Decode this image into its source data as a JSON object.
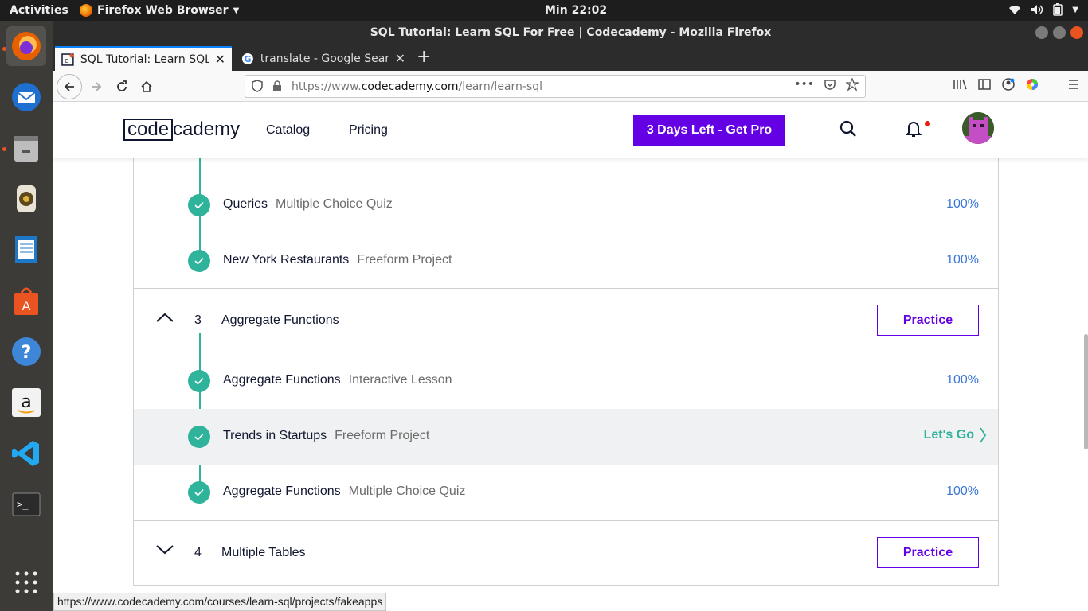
{
  "system": {
    "activities": "Activities",
    "app_menu": "Firefox Web Browser",
    "clock": "Min 22:02"
  },
  "window": {
    "title": "SQL Tutorial: Learn SQL For Free | Codecademy - Mozilla Firefox"
  },
  "tabs": [
    {
      "label": "SQL Tutorial: Learn SQL For Free",
      "active": true
    },
    {
      "label": "translate - Google Search",
      "active": false
    }
  ],
  "urlbar": {
    "prefix": "https://www.",
    "domain": "codecademy.com",
    "path": "/learn/learn-sql"
  },
  "site": {
    "logo_left": "code",
    "logo_right": "cademy",
    "nav": {
      "catalog": "Catalog",
      "pricing": "Pricing"
    },
    "pro_button": "3 Days Left - Get Pro"
  },
  "syllabus": {
    "items_top": [
      {
        "name": "Queries",
        "type": "Multiple Choice Quiz",
        "status": "100%"
      },
      {
        "name": "New York Restaurants",
        "type": "Freeform Project",
        "status": "100%"
      }
    ],
    "module3": {
      "number": "3",
      "title": "Aggregate Functions",
      "practice": "Practice"
    },
    "module3_items": [
      {
        "name": "Aggregate Functions",
        "type": "Interactive Lesson",
        "status": "100%"
      },
      {
        "name": "Trends in Startups",
        "type": "Freeform Project",
        "status": "Let's Go"
      },
      {
        "name": "Aggregate Functions",
        "type": "Multiple Choice Quiz",
        "status": "100%"
      }
    ],
    "module4": {
      "number": "4",
      "title": "Multiple Tables",
      "practice": "Practice"
    }
  },
  "status_url": "https://www.codecademy.com/courses/learn-sql/projects/fakeapps",
  "colors": {
    "accent": "#6400e4",
    "check": "#2fb39b",
    "percent": "#3a76d8"
  }
}
